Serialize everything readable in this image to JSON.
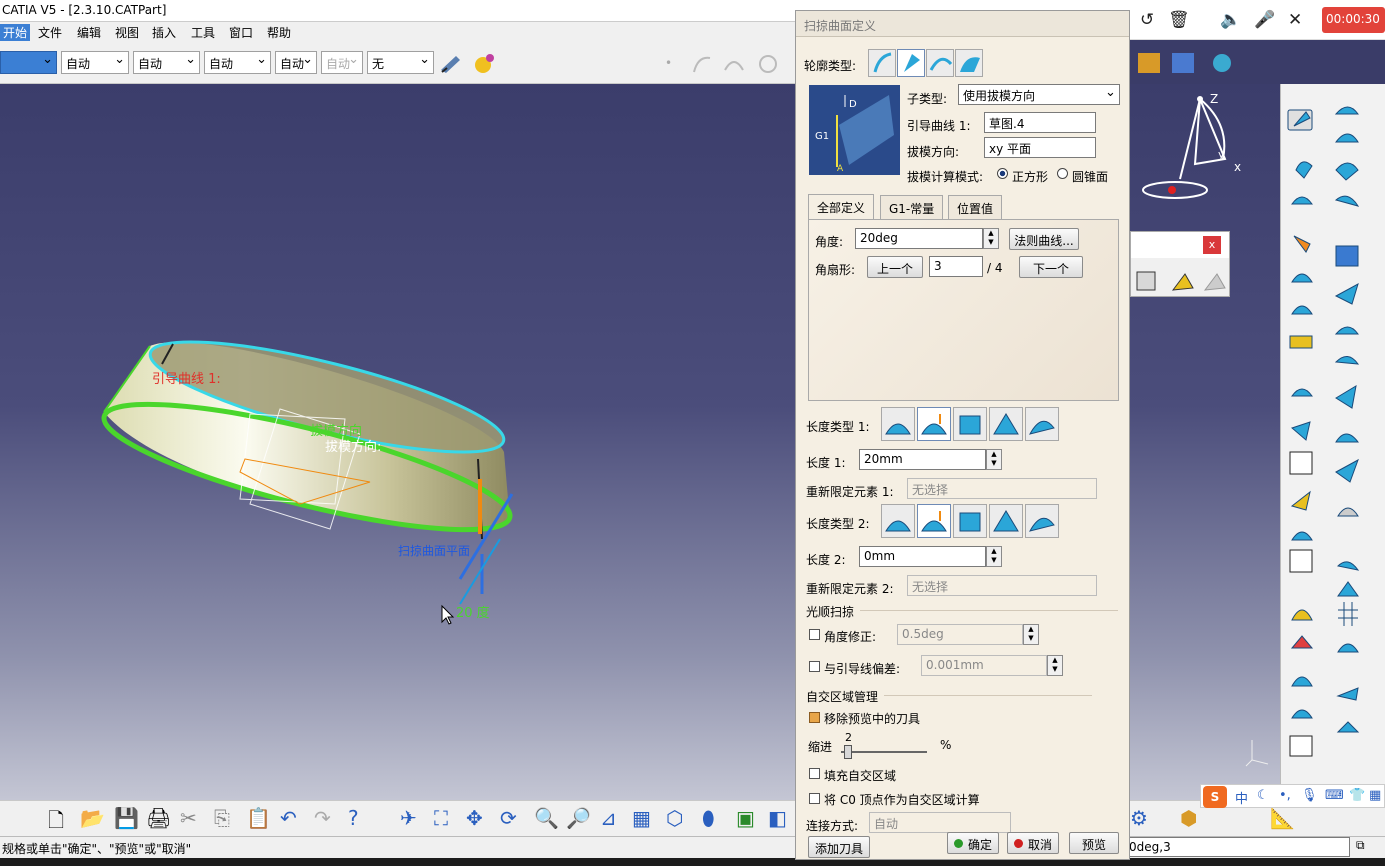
{
  "window": {
    "title": "CATIA V5 - [2.3.10.CATPart]"
  },
  "menu": [
    "开始",
    "文件",
    "编辑",
    "视图",
    "插入",
    "工具",
    "窗口",
    "帮助"
  ],
  "toolbar_combos": [
    "自动",
    "自动",
    "自动",
    "自动",
    "自动",
    "无"
  ],
  "viewport": {
    "labels": {
      "guide_curve": "引导曲线 1:",
      "draft_direction_1": "拔模方向",
      "draft_direction_2": "拔模方向:",
      "sweep_plane": "扫掠曲面平面",
      "angle": "20 度"
    },
    "axis": {
      "z": "Z",
      "y": "y",
      "x": "x"
    }
  },
  "annotation_toolbar": {
    "timer": "00:00:30"
  },
  "dialog": {
    "title": "扫掠曲面定义",
    "profile_type_label": "轮廓类型:",
    "subtype_label": "子类型:",
    "subtype_value": "使用拔模方向",
    "guide_curve_label": "引导曲线 1:",
    "guide_curve_value": "草图.4",
    "draft_direction_label": "拔模方向:",
    "draft_direction_value": "xy 平面",
    "draft_mode_label": "拔模计算模式:",
    "mode_square": "正方形",
    "mode_cone": "圆锥面",
    "tabs": [
      "全部定义",
      "G1-常量",
      "位置值"
    ],
    "angle_label": "角度:",
    "angle_value": "20deg",
    "law_button": "法则曲线...",
    "sector_label": "角扇形:",
    "prev_button": "上一个",
    "sector_value": "3",
    "sector_total": "/ 4",
    "next_button": "下一个",
    "length_type_1_label": "长度类型 1:",
    "length_1_label": "长度 1:",
    "length_1_value": "20mm",
    "relimit_1_label": "重新限定元素 1:",
    "relimit_1_value": "无选择",
    "length_type_2_label": "长度类型 2:",
    "length_2_label": "长度 2:",
    "length_2_value": "0mm",
    "relimit_2_label": "重新限定元素 2:",
    "relimit_2_value": "无选择",
    "smooth_section": "光顺扫掠",
    "angle_correction_label": "角度修正:",
    "angle_correction_value": "0.5deg",
    "deviation_label": "与引导线偏差:",
    "deviation_value": "0.001mm",
    "self_intersection_section": "自交区域管理",
    "remove_tools_label": "移除预览中的刀具",
    "indent_label": "缩进",
    "indent_value": "2",
    "indent_unit": "%",
    "fill_label": "填充自交区域",
    "c0_label": "将 C0 顶点作为自交区域计算",
    "connect_label": "连接方式:",
    "connect_value": "自动",
    "add_tool_button": "添加刀具",
    "ok_button": "确定",
    "cancel_button": "取消",
    "preview_button": "预览"
  },
  "status": {
    "left": "规格或单击\"确定\"、\"预览\"或\"取消\"",
    "right": "0deg,3"
  },
  "ime": {
    "zh": "中"
  },
  "colors": {
    "accent": "#3b7fd4",
    "dialog_bg": "#f5efe3",
    "timer": "#e2433a"
  }
}
